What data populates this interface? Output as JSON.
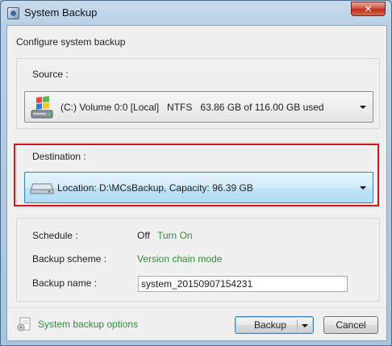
{
  "window": {
    "title": "System Backup",
    "close_label": "✕"
  },
  "dialog": {
    "heading": "Configure system backup"
  },
  "source": {
    "label": "Source :",
    "value": "(C:) Volume 0:0 [Local]   NTFS   63.86 GB of 116.00 GB used"
  },
  "destination": {
    "label": "Destination :",
    "value": "Location: D:\\MCsBackup, Capacity: 96.39 GB"
  },
  "settings": {
    "schedule_label": "Schedule :",
    "schedule_value": "Off",
    "schedule_link": "Turn On",
    "scheme_label": "Backup scheme :",
    "scheme_value": "Version chain mode",
    "name_label": "Backup name :",
    "name_value": "system_20150907154231"
  },
  "footer": {
    "options_link": "System backup options",
    "backup_button": "Backup",
    "cancel_button": "Cancel"
  },
  "colors": {
    "highlight": "#d9111a",
    "link": "#2e8b37"
  }
}
